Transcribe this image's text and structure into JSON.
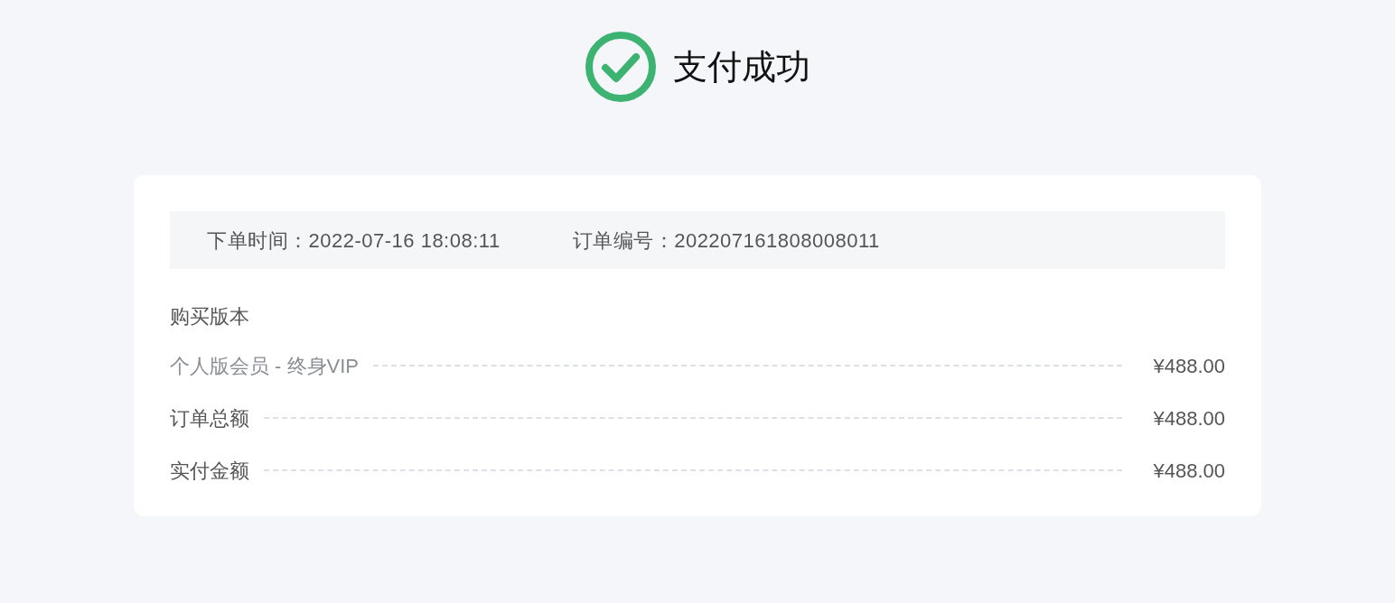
{
  "header": {
    "title": "支付成功"
  },
  "order_info": [
    {
      "label": "下单时间：",
      "value": "2022-07-16 18:08:11"
    },
    {
      "label": "订单编号：",
      "value": "202207161808008011"
    }
  ],
  "section_title": "购买版本",
  "lines": [
    {
      "kind": "item",
      "label": "个人版会员 - 终身VIP",
      "amount": "¥488.00"
    },
    {
      "kind": "total",
      "label": "订单总额",
      "amount": "¥488.00"
    },
    {
      "kind": "total",
      "label": "实付金额",
      "amount": "¥488.00"
    }
  ]
}
